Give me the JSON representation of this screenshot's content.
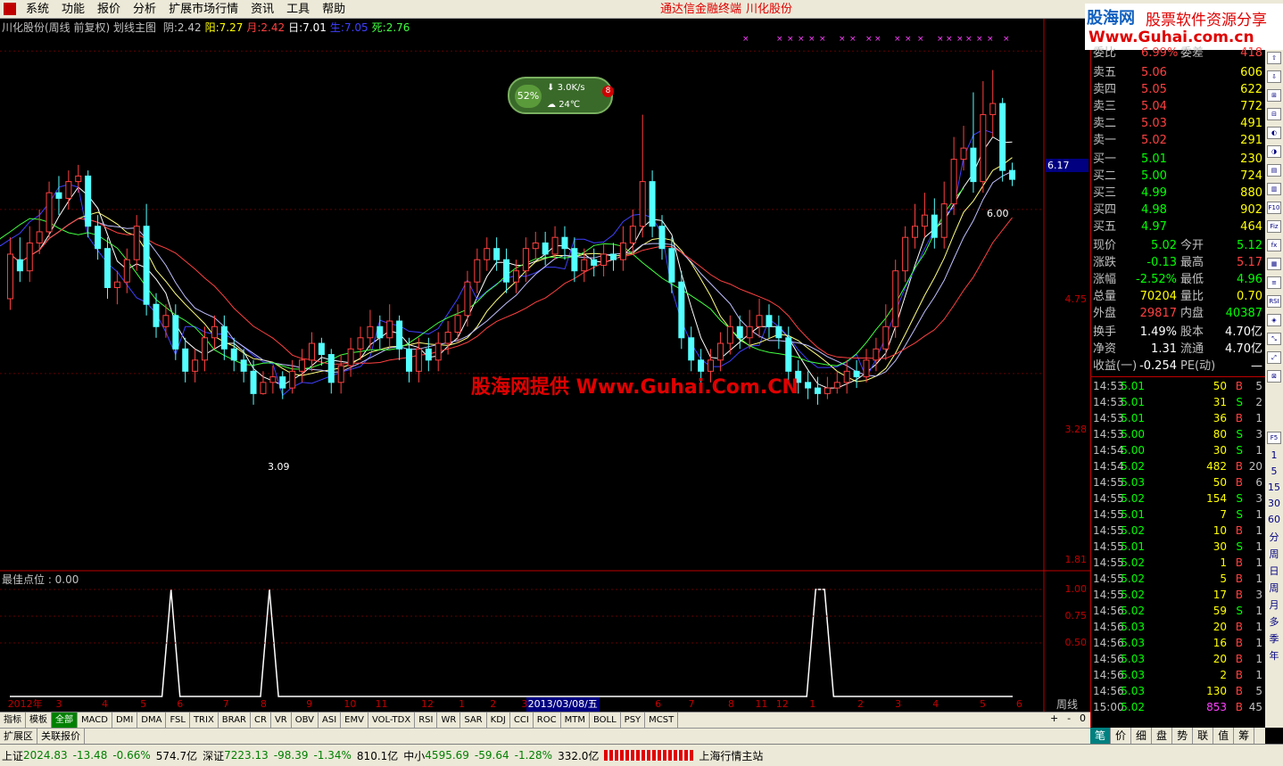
{
  "menubar": {
    "items": [
      "系统",
      "功能",
      "报价",
      "分析",
      "扩展市场行情",
      "资讯",
      "工具",
      "帮助"
    ],
    "terminal_title": "通达信金融终端",
    "stock_title": "川化股份"
  },
  "ad": {
    "brand": "股海网",
    "slogan": "股票软件资源分享",
    "url": "Www.Guhai.com.cn"
  },
  "main_info": {
    "stock": "川化股份(周线 前复权) 划线主图",
    "indicators": [
      {
        "label": "阴:",
        "value": "2.42",
        "color": "#c0c0c0"
      },
      {
        "label": "阳:",
        "value": "7.27",
        "color": "#ffff00"
      },
      {
        "label": "月:",
        "value": "2.42",
        "color": "#ff4040"
      },
      {
        "label": "日:",
        "value": "7.01",
        "color": "#ffffff"
      },
      {
        "label": "生:",
        "value": "7.05",
        "color": "#4040ff"
      },
      {
        "label": "死:",
        "value": "2.76",
        "color": "#40ff40"
      }
    ]
  },
  "widget": {
    "percent": "52%",
    "speed": "3.0K/s",
    "temp": "24℃",
    "badge": "8"
  },
  "watermark": "股海网提供 Www.Guhai.Com.CN",
  "price_axis": {
    "labels": [
      "4.75",
      "3.28",
      "1.81"
    ],
    "current": "6.17"
  },
  "annotations": {
    "low": "3.09",
    "high": "6.00"
  },
  "sub_chart": {
    "title": "最佳点位 : 0.00",
    "axis_labels": [
      "1.00",
      "0.75",
      "0.50"
    ],
    "values": [
      0,
      0,
      0,
      0,
      0,
      0,
      0,
      0,
      0,
      0,
      0,
      0,
      0,
      0,
      0,
      0,
      0,
      0,
      1,
      0,
      0,
      0,
      0,
      0,
      0,
      0,
      0,
      0,
      0,
      1,
      0,
      0,
      0,
      0,
      0,
      0,
      0,
      0,
      0,
      0,
      0,
      0,
      0,
      0,
      0,
      0,
      0,
      0,
      0,
      0,
      0,
      0,
      0,
      0,
      0,
      0,
      0,
      0,
      0,
      0,
      0,
      0,
      0,
      0,
      0,
      0,
      0,
      0,
      0,
      0,
      0,
      0,
      0,
      0,
      0,
      0,
      0,
      0,
      0,
      0,
      0,
      0,
      0,
      0,
      0,
      0,
      0,
      0,
      0,
      0,
      1,
      1,
      0,
      0,
      0,
      0,
      0,
      0,
      0,
      0,
      0,
      0,
      0,
      0,
      0,
      0,
      0,
      0,
      0,
      0,
      0,
      0,
      0
    ]
  },
  "date_axis": {
    "ticks": [
      {
        "label": "2012年",
        "pos": 0.004
      },
      {
        "label": "3",
        "pos": 0.05
      },
      {
        "label": "4",
        "pos": 0.094
      },
      {
        "label": "5",
        "pos": 0.131
      },
      {
        "label": "6",
        "pos": 0.166
      },
      {
        "label": "7",
        "pos": 0.21
      },
      {
        "label": "8",
        "pos": 0.246
      },
      {
        "label": "9",
        "pos": 0.29
      },
      {
        "label": "10",
        "pos": 0.326
      },
      {
        "label": "11",
        "pos": 0.356
      },
      {
        "label": "12",
        "pos": 0.4
      },
      {
        "label": "1",
        "pos": 0.436
      },
      {
        "label": "2",
        "pos": 0.466
      },
      {
        "label": "3",
        "pos": 0.496
      },
      {
        "label": "6",
        "pos": 0.624
      },
      {
        "label": "7",
        "pos": 0.656
      },
      {
        "label": "8",
        "pos": 0.694
      },
      {
        "label": "11",
        "pos": 0.72
      },
      {
        "label": "12",
        "pos": 0.74
      },
      {
        "label": "1",
        "pos": 0.772
      },
      {
        "label": "2",
        "pos": 0.818
      },
      {
        "label": "3",
        "pos": 0.854
      },
      {
        "label": "4",
        "pos": 0.89
      },
      {
        "label": "5",
        "pos": 0.935
      },
      {
        "label": "6",
        "pos": 0.97
      }
    ],
    "selected": "2013/03/08/五",
    "selected_pos": 0.504,
    "period": "周线"
  },
  "indicator_tabs": [
    "指标",
    "模板",
    "全部",
    "MACD",
    "DMI",
    "DMA",
    "FSL",
    "TRIX",
    "BRAR",
    "CR",
    "VR",
    "OBV",
    "ASI",
    "EMV",
    "VOL-TDX",
    "RSI",
    "WR",
    "SAR",
    "KDJ",
    "CCI",
    "ROC",
    "MTM",
    "BOLL",
    "PSY",
    "MCST"
  ],
  "bottom_tabs": [
    "扩展区",
    "关联报价"
  ],
  "zoom_controls": [
    "+",
    "-",
    "0"
  ],
  "order_book": {
    "top": {
      "label": "委比",
      "pct": "6.99%",
      "label2": "委差",
      "value": "418"
    },
    "sells": [
      {
        "label": "卖五",
        "price": "5.06",
        "vol": "606"
      },
      {
        "label": "卖四",
        "price": "5.05",
        "vol": "622"
      },
      {
        "label": "卖三",
        "price": "5.04",
        "vol": "772"
      },
      {
        "label": "卖二",
        "price": "5.03",
        "vol": "491"
      },
      {
        "label": "卖一",
        "price": "5.02",
        "vol": "291"
      }
    ],
    "buys": [
      {
        "label": "买一",
        "price": "5.01",
        "vol": "230"
      },
      {
        "label": "买二",
        "price": "5.00",
        "vol": "724"
      },
      {
        "label": "买三",
        "price": "4.99",
        "vol": "880"
      },
      {
        "label": "买四",
        "price": "4.98",
        "vol": "902"
      },
      {
        "label": "买五",
        "price": "4.97",
        "vol": "464"
      }
    ]
  },
  "quote": [
    {
      "l1": "现价",
      "v1": "5.02",
      "c1": "#00ff00",
      "l2": "今开",
      "v2": "5.12",
      "c2": "#00ff00"
    },
    {
      "l1": "涨跌",
      "v1": "-0.13",
      "c1": "#00ff00",
      "l2": "最高",
      "v2": "5.17",
      "c2": "#ff4040"
    },
    {
      "l1": "涨幅",
      "v1": "-2.52%",
      "c1": "#00ff00",
      "l2": "最低",
      "v2": "4.96",
      "c2": "#00ff00"
    },
    {
      "l1": "总量",
      "v1": "70204",
      "c1": "#ffff00",
      "l2": "量比",
      "v2": "0.70",
      "c2": "#ffff00"
    },
    {
      "l1": "外盘",
      "v1": "29817",
      "c1": "#ff4040",
      "l2": "内盘",
      "v2": "40387",
      "c2": "#00ff00"
    },
    {
      "l1": "换手",
      "v1": "1.49%",
      "c1": "#ffffff",
      "l2": "股本",
      "v2": "4.70亿",
      "c2": "#ffffff"
    },
    {
      "l1": "净资",
      "v1": "1.31",
      "c1": "#ffffff",
      "l2": "流通",
      "v2": "4.70亿",
      "c2": "#ffffff"
    },
    {
      "l1": "收益(一)",
      "v1": "-0.254",
      "c1": "#ffffff",
      "l2": "PE(动)",
      "v2": "—",
      "c2": "#ffffff"
    }
  ],
  "ticks": [
    {
      "t": "14:53",
      "p": "5.01",
      "v": "50",
      "s": "B",
      "n": "5"
    },
    {
      "t": "14:53",
      "p": "5.01",
      "v": "31",
      "s": "S",
      "n": "2"
    },
    {
      "t": "14:53",
      "p": "5.01",
      "v": "36",
      "s": "B",
      "n": "1"
    },
    {
      "t": "14:53",
      "p": "5.00",
      "v": "80",
      "s": "S",
      "n": "3"
    },
    {
      "t": "14:54",
      "p": "5.00",
      "v": "30",
      "s": "S",
      "n": "1"
    },
    {
      "t": "14:54",
      "p": "5.02",
      "v": "482",
      "s": "B",
      "n": "20"
    },
    {
      "t": "14:55",
      "p": "5.03",
      "v": "50",
      "s": "B",
      "n": "6"
    },
    {
      "t": "14:55",
      "p": "5.02",
      "v": "154",
      "s": "S",
      "n": "3"
    },
    {
      "t": "14:55",
      "p": "5.01",
      "v": "7",
      "s": "S",
      "n": "1"
    },
    {
      "t": "14:55",
      "p": "5.02",
      "v": "10",
      "s": "B",
      "n": "1"
    },
    {
      "t": "14:55",
      "p": "5.01",
      "v": "30",
      "s": "S",
      "n": "1"
    },
    {
      "t": "14:55",
      "p": "5.02",
      "v": "1",
      "s": "B",
      "n": "1"
    },
    {
      "t": "14:55",
      "p": "5.02",
      "v": "5",
      "s": "B",
      "n": "1"
    },
    {
      "t": "14:55",
      "p": "5.02",
      "v": "17",
      "s": "B",
      "n": "3"
    },
    {
      "t": "14:56",
      "p": "5.02",
      "v": "59",
      "s": "S",
      "n": "1"
    },
    {
      "t": "14:56",
      "p": "5.03",
      "v": "20",
      "s": "B",
      "n": "1"
    },
    {
      "t": "14:56",
      "p": "5.03",
      "v": "16",
      "s": "B",
      "n": "1"
    },
    {
      "t": "14:56",
      "p": "5.03",
      "v": "20",
      "s": "B",
      "n": "1"
    },
    {
      "t": "14:56",
      "p": "5.03",
      "v": "2",
      "s": "B",
      "n": "1"
    },
    {
      "t": "14:56",
      "p": "5.03",
      "v": "130",
      "s": "B",
      "n": "5"
    },
    {
      "t": "15:00",
      "p": "5.02",
      "v": "853",
      "s": "B",
      "n": "45"
    }
  ],
  "right_tabs": [
    "笔",
    "价",
    "细",
    "盘",
    "势",
    "联",
    "值",
    "筹"
  ],
  "side_strip": [
    "分",
    "周",
    "日",
    "周",
    "月",
    "多",
    "季",
    "年"
  ],
  "side_numbers": [
    "1",
    "5",
    "15",
    "30",
    "60"
  ],
  "status": {
    "sh_label": "上证",
    "sh_val": "2024.83",
    "sh_chg": "-13.48",
    "sh_pct": "-0.66%",
    "sh_amt": "574.7亿",
    "sz_label": "深证",
    "sz_val": "7223.13",
    "sz_chg": "-98.39",
    "sz_pct": "-1.34%",
    "sz_amt": "810.1亿",
    "zx_label": "中小",
    "zx_val": "4595.69",
    "zx_chg": "-59.64",
    "zx_pct": "-1.28%",
    "zx_amt": "332.0亿",
    "server": "上海行情主站"
  },
  "chart_data": {
    "type": "candlestick",
    "candles": [
      [
        3.95,
        4.35,
        4.5,
        3.85
      ],
      [
        4.3,
        4.2,
        4.5,
        4.1
      ],
      [
        4.2,
        4.45,
        4.6,
        4.1
      ],
      [
        4.45,
        4.55,
        4.75,
        4.35
      ],
      [
        4.55,
        4.9,
        5.0,
        4.5
      ],
      [
        4.9,
        4.85,
        5.05,
        4.7
      ],
      [
        4.85,
        5.0,
        5.1,
        4.75
      ],
      [
        5.0,
        5.05,
        5.15,
        4.9
      ],
      [
        5.05,
        4.6,
        5.1,
        4.5
      ],
      [
        4.6,
        4.4,
        4.7,
        4.3
      ],
      [
        4.4,
        4.05,
        4.5,
        3.95
      ],
      [
        4.05,
        4.1,
        4.2,
        3.9
      ],
      [
        4.1,
        4.3,
        4.4,
        4.0
      ],
      [
        4.3,
        4.6,
        4.7,
        4.2
      ],
      [
        4.6,
        3.9,
        4.8,
        3.8
      ],
      [
        3.9,
        3.7,
        4.0,
        3.6
      ],
      [
        3.7,
        3.8,
        3.9,
        3.6
      ],
      [
        3.8,
        3.5,
        3.9,
        3.4
      ],
      [
        3.5,
        3.3,
        3.6,
        3.2
      ],
      [
        3.3,
        3.4,
        3.5,
        3.2
      ],
      [
        3.4,
        3.6,
        3.7,
        3.3
      ],
      [
        3.6,
        3.7,
        3.8,
        3.5
      ],
      [
        3.7,
        3.5,
        3.8,
        3.4
      ],
      [
        3.5,
        3.4,
        3.6,
        3.3
      ],
      [
        3.4,
        3.3,
        3.5,
        3.2
      ],
      [
        3.3,
        3.1,
        3.4,
        3.0
      ],
      [
        3.1,
        3.2,
        3.3,
        3.09
      ],
      [
        3.2,
        3.25,
        3.35,
        3.1
      ],
      [
        3.25,
        3.15,
        3.3,
        3.05
      ],
      [
        3.15,
        3.3,
        3.4,
        3.1
      ],
      [
        3.3,
        3.4,
        3.5,
        3.2
      ],
      [
        3.4,
        3.55,
        3.65,
        3.3
      ],
      [
        3.55,
        3.45,
        3.6,
        3.35
      ],
      [
        3.45,
        3.2,
        3.5,
        3.1
      ],
      [
        3.2,
        3.35,
        3.45,
        3.1
      ],
      [
        3.35,
        3.5,
        3.6,
        3.25
      ],
      [
        3.5,
        3.6,
        3.7,
        3.4
      ],
      [
        3.6,
        3.7,
        3.85,
        3.5
      ],
      [
        3.7,
        3.6,
        3.8,
        3.5
      ],
      [
        3.6,
        3.75,
        3.9,
        3.5
      ],
      [
        3.75,
        3.5,
        3.8,
        3.4
      ],
      [
        3.5,
        3.3,
        3.6,
        3.2
      ],
      [
        3.3,
        3.5,
        3.6,
        3.2
      ],
      [
        3.5,
        3.4,
        3.6,
        3.3
      ],
      [
        3.4,
        3.55,
        3.65,
        3.3
      ],
      [
        3.55,
        3.65,
        3.75,
        3.45
      ],
      [
        3.65,
        3.8,
        3.9,
        3.55
      ],
      [
        3.8,
        4.1,
        4.2,
        3.7
      ],
      [
        4.1,
        4.3,
        4.4,
        4.0
      ],
      [
        4.3,
        4.4,
        4.5,
        4.2
      ],
      [
        4.4,
        4.3,
        4.5,
        4.2
      ],
      [
        4.3,
        4.1,
        4.4,
        4.0
      ],
      [
        4.1,
        4.2,
        4.3,
        4.0
      ],
      [
        4.2,
        4.4,
        4.5,
        4.1
      ],
      [
        4.4,
        4.45,
        4.55,
        4.3
      ],
      [
        4.45,
        4.35,
        4.55,
        4.25
      ],
      [
        4.35,
        4.5,
        4.6,
        4.3
      ],
      [
        4.5,
        4.4,
        4.6,
        4.3
      ],
      [
        4.4,
        4.2,
        4.5,
        4.1
      ],
      [
        4.2,
        4.3,
        4.4,
        4.1
      ],
      [
        4.3,
        4.25,
        4.4,
        4.15
      ],
      [
        4.25,
        4.35,
        4.45,
        4.15
      ],
      [
        4.35,
        4.3,
        4.45,
        4.2
      ],
      [
        4.3,
        4.45,
        4.6,
        4.2
      ],
      [
        4.45,
        4.6,
        4.75,
        4.35
      ],
      [
        4.6,
        5.0,
        5.6,
        4.5
      ],
      [
        5.0,
        4.6,
        5.1,
        4.5
      ],
      [
        4.6,
        4.4,
        4.7,
        4.3
      ],
      [
        4.4,
        4.1,
        4.5,
        4.0
      ],
      [
        4.1,
        3.6,
        4.2,
        3.5
      ],
      [
        3.6,
        3.4,
        3.7,
        3.3
      ],
      [
        3.4,
        3.3,
        3.5,
        3.2
      ],
      [
        3.3,
        3.4,
        3.5,
        3.2
      ],
      [
        3.4,
        3.55,
        3.65,
        3.3
      ],
      [
        3.55,
        3.7,
        3.8,
        3.45
      ],
      [
        3.7,
        3.6,
        3.8,
        3.5
      ],
      [
        3.6,
        3.7,
        3.85,
        3.5
      ],
      [
        3.7,
        3.8,
        3.95,
        3.6
      ],
      [
        3.8,
        3.7,
        3.9,
        3.6
      ],
      [
        3.7,
        3.6,
        3.8,
        3.5
      ],
      [
        3.6,
        3.3,
        3.7,
        3.2
      ],
      [
        3.3,
        3.2,
        3.4,
        3.1
      ],
      [
        3.2,
        3.15,
        3.3,
        3.05
      ],
      [
        3.15,
        3.1,
        3.25,
        3.0
      ],
      [
        3.1,
        3.15,
        3.25,
        3.05
      ],
      [
        3.15,
        3.2,
        3.3,
        3.1
      ],
      [
        3.2,
        3.3,
        3.4,
        3.1
      ],
      [
        3.3,
        3.25,
        3.4,
        3.15
      ],
      [
        3.25,
        3.4,
        3.5,
        3.2
      ],
      [
        3.4,
        3.5,
        3.6,
        3.3
      ],
      [
        3.5,
        3.7,
        3.9,
        3.4
      ],
      [
        3.7,
        4.2,
        4.3,
        3.6
      ],
      [
        4.2,
        4.5,
        4.6,
        4.1
      ],
      [
        4.5,
        4.6,
        4.8,
        4.4
      ],
      [
        4.6,
        4.7,
        4.9,
        4.5
      ],
      [
        4.7,
        4.5,
        4.85,
        4.4
      ],
      [
        4.5,
        4.8,
        5.0,
        4.4
      ],
      [
        4.8,
        5.2,
        5.4,
        4.7
      ],
      [
        5.2,
        5.3,
        5.5,
        5.1
      ],
      [
        5.3,
        5.0,
        5.8,
        4.9
      ],
      [
        5.0,
        5.6,
        5.9,
        4.9
      ],
      [
        5.6,
        5.7,
        6.0,
        5.4
      ],
      [
        5.7,
        5.1,
        5.75,
        5.0
      ],
      [
        5.1,
        5.02,
        5.17,
        4.96
      ]
    ],
    "ylim": [
      1.81,
      6.17
    ]
  }
}
